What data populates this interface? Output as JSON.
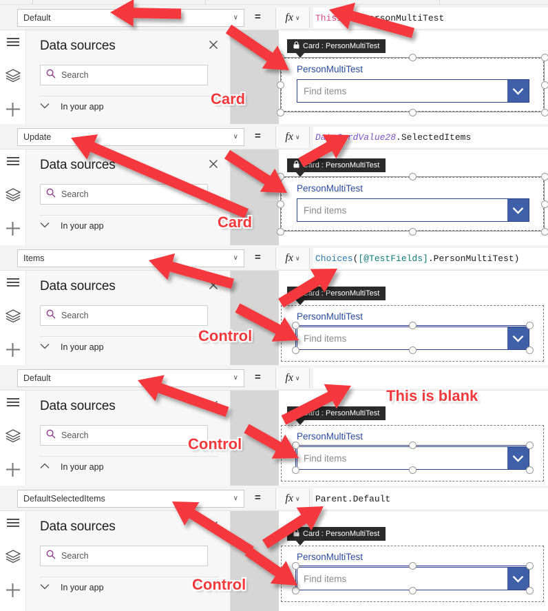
{
  "panel": {
    "title": "Data sources",
    "close_icon": "close-icon",
    "search_placeholder": "Search",
    "search_icon": "search-icon",
    "group_label": "In your app",
    "chevron_icon": "chevron-down-icon"
  },
  "rail": {
    "menu_icon": "hamburger-menu-icon",
    "layers_icon": "layers-icon",
    "add_icon": "plus-icon"
  },
  "formula_bar": {
    "equals": "=",
    "fx_label": "fx",
    "fx_caret": "∨",
    "select_caret": "∨"
  },
  "card": {
    "tooltip_label": "Card : PersonMultiTest",
    "lock_icon": "lock-icon",
    "field_label": "PersonMultiTest",
    "combo_placeholder": "Find items",
    "dropdown_icon": "chevron-down-icon"
  },
  "colors": {
    "annotation_red": "#f4393c",
    "combo_border": "#2b3f8c",
    "dropdown_button": "#3f5fa8",
    "field_label": "#2b4aa0",
    "search_icon": "#8e2f8e",
    "tooltip_bg": "#2b2b2b",
    "canvas_bg": "#d6d6d6",
    "panel_bg": "#f7f7f7"
  },
  "rows": [
    {
      "property": "Default",
      "formula_tokens": [
        {
          "text": "ThisItem",
          "style": "ident"
        },
        {
          "text": ".PersonMultiTest",
          "style": "plain"
        }
      ],
      "annotation": "Card",
      "selection_target": "card"
    },
    {
      "property": "Update",
      "formula_tokens": [
        {
          "text": "DataCardValue28",
          "style": "purple"
        },
        {
          "text": ".SelectedItems",
          "style": "plain"
        }
      ],
      "annotation": "Card",
      "selection_target": "card"
    },
    {
      "property": "Items",
      "formula_tokens": [
        {
          "text": "Choices",
          "style": "fn"
        },
        {
          "text": "(",
          "style": "plain"
        },
        {
          "text": "[@TestFields]",
          "style": "teal"
        },
        {
          "text": ".PersonMultiTest)",
          "style": "plain"
        }
      ],
      "annotation": "Control",
      "selection_target": "control"
    },
    {
      "property": "Default",
      "formula_tokens": [],
      "annotation": "Control",
      "annotation_extra": "This is blank",
      "selection_target": "control"
    },
    {
      "property": "DefaultSelectedItems",
      "formula_tokens": [
        {
          "text": "Parent.Default",
          "style": "plain"
        }
      ],
      "annotation": "Control",
      "selection_target": "control"
    }
  ]
}
